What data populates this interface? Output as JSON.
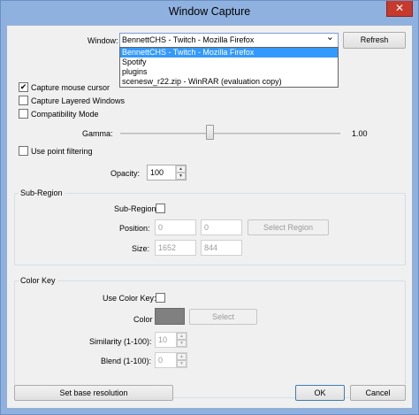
{
  "window": {
    "title": "Window Capture",
    "close_glyph": "✕"
  },
  "window_select": {
    "label": "Window:",
    "selected": "BennettCHS - Twitch - Mozilla Firefox",
    "options": [
      "BennettCHS - Twitch - Mozilla Firefox",
      "Spotify",
      "plugins",
      "scenesw_r22.zip - WinRAR (evaluation copy)"
    ],
    "refresh_label": "Refresh"
  },
  "options": {
    "capture_mouse_cursor": {
      "label": "Capture mouse cursor",
      "checked": true
    },
    "capture_layered_windows": {
      "label": "Capture Layered Windows",
      "checked": false
    },
    "compatibility_mode": {
      "label": "Compatibility Mode",
      "checked": false
    },
    "use_point_filtering": {
      "label": "Use point filtering",
      "checked": false
    }
  },
  "gamma": {
    "label": "Gamma:",
    "value_text": "1.00"
  },
  "opacity": {
    "label": "Opacity:",
    "value": "100"
  },
  "sub_region": {
    "title": "Sub-Region",
    "toggle_label": "Sub-Region",
    "checked": false,
    "position_label": "Position:",
    "position_x": "0",
    "position_y": "0",
    "select_region_label": "Select Region",
    "size_label": "Size:",
    "size_w": "1652",
    "size_h": "844"
  },
  "color_key": {
    "title": "Color Key",
    "use_label": "Use Color Key:",
    "checked": false,
    "color_label": "Color",
    "swatch_color": "#808080",
    "select_label": "Select",
    "similarity_label": "Similarity (1-100):",
    "similarity_value": "10",
    "blend_label": "Blend (1-100):",
    "blend_value": "0"
  },
  "footer": {
    "set_base_resolution_label": "Set base resolution",
    "ok_label": "OK",
    "cancel_label": "Cancel"
  },
  "glyphs": {
    "check": "✔",
    "arrow_up": "▲",
    "arrow_down": "▼",
    "combo_arrow": "⌄"
  }
}
